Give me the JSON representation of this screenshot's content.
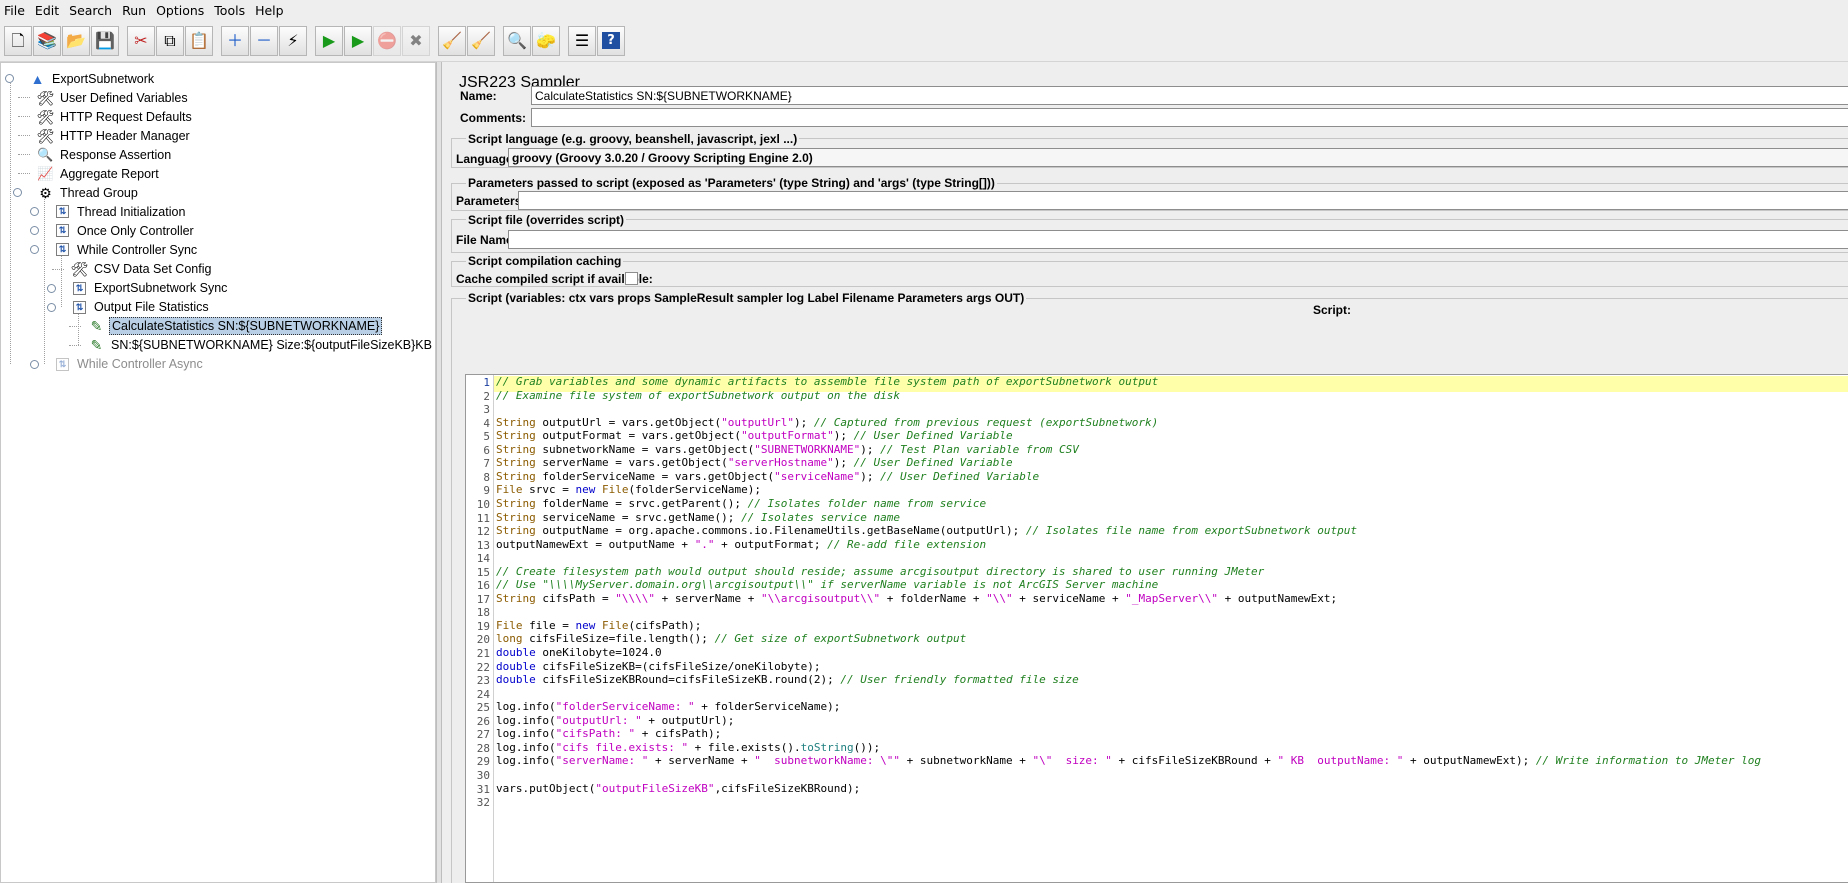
{
  "menu": [
    "File",
    "Edit",
    "Search",
    "Run",
    "Options",
    "Tools",
    "Help"
  ],
  "toolbar": [
    {
      "name": "new-icon",
      "glyph": "🗋"
    },
    {
      "name": "templates-icon",
      "glyph": "📚"
    },
    {
      "name": "open-icon",
      "glyph": "📂"
    },
    {
      "name": "save-icon",
      "glyph": "💾"
    },
    {
      "name": "cut-icon",
      "glyph": "✂"
    },
    {
      "name": "copy-icon",
      "glyph": "⧉"
    },
    {
      "name": "paste-icon",
      "glyph": "📋"
    },
    {
      "name": "expand-icon",
      "glyph": "＋"
    },
    {
      "name": "collapse-icon",
      "glyph": "－"
    },
    {
      "name": "toggle-icon",
      "glyph": "⚡"
    },
    {
      "name": "start-icon",
      "glyph": "▶"
    },
    {
      "name": "start-no-pauses-icon",
      "glyph": "▶"
    },
    {
      "name": "stop-icon",
      "glyph": "⛔"
    },
    {
      "name": "shutdown-icon",
      "glyph": "✖"
    },
    {
      "name": "clear-icon",
      "glyph": "🧹"
    },
    {
      "name": "clear-all-icon",
      "glyph": "🧹"
    },
    {
      "name": "search-icon",
      "glyph": "🔍"
    },
    {
      "name": "reset-search-icon",
      "glyph": "🧽"
    },
    {
      "name": "function-helper-icon",
      "glyph": "☰"
    },
    {
      "name": "help-icon",
      "glyph": "?"
    }
  ],
  "tree": [
    {
      "label": "ExportSubnetwork",
      "icon": "testplan-icon"
    },
    {
      "label": "User Defined Variables",
      "icon": "config-icon"
    },
    {
      "label": "HTTP Request Defaults",
      "icon": "config-icon"
    },
    {
      "label": "HTTP Header Manager",
      "icon": "config-icon"
    },
    {
      "label": "Response Assertion",
      "icon": "assertion-icon"
    },
    {
      "label": "Aggregate Report",
      "icon": "report-icon"
    },
    {
      "label": "Thread Group",
      "icon": "thread-group-icon"
    },
    {
      "label": "Thread Initialization",
      "icon": "controller-icon"
    },
    {
      "label": "Once Only Controller",
      "icon": "controller-icon"
    },
    {
      "label": "While Controller Sync",
      "icon": "controller-icon"
    },
    {
      "label": "CSV Data Set Config",
      "icon": "config-icon"
    },
    {
      "label": "ExportSubnetwork Sync",
      "icon": "controller-icon"
    },
    {
      "label": "Output File Statistics",
      "icon": "controller-icon"
    },
    {
      "label": "CalculateStatistics SN:${SUBNETWORKNAME}",
      "icon": "sampler-icon"
    },
    {
      "label": "SN:${SUBNETWORKNAME} Size:${outputFileSizeKB}KB",
      "icon": "sampler-icon"
    },
    {
      "label": "While Controller Async",
      "icon": "controller-icon"
    }
  ],
  "sampler": {
    "title": "JSR223 Sampler",
    "name_label": "Name:",
    "name_value": "CalculateStatistics SN:${SUBNETWORKNAME}",
    "comments_label": "Comments:",
    "comments_value": "",
    "lang_section": "Script language (e.g. groovy, beanshell, javascript, jexl ...)",
    "lang_label": "Language:",
    "lang_value": "groovy     (Groovy 3.0.20 / Groovy Scripting Engine 2.0)",
    "params_section": "Parameters passed to script (exposed as 'Parameters' (type String) and 'args' (type String[]))",
    "params_label": "Parameters:",
    "params_value": "",
    "file_section": "Script file (overrides script)",
    "file_label": "File Name:",
    "file_value": "",
    "cache_section": "Script compilation caching",
    "cache_label": "Cache compiled script if available:",
    "cache_checked": false,
    "script_section": "Script (variables: ctx vars props SampleResult sampler log Label Filename Parameters args OUT)",
    "script_header": "Script:"
  },
  "editor": {
    "current_line": 1,
    "highlight_color": "#ffffaa",
    "lines": [
      "// Grab variables and some dynamic artifacts to assemble file system path of exportSubnetwork output",
      "// Examine file system of exportSubnetwork output on the disk",
      "",
      "String outputUrl = vars.getObject(\"outputUrl\"); // Captured from previous request (exportSubnetwork)",
      "String outputFormat = vars.getObject(\"outputFormat\"); // User Defined Variable",
      "String subnetworkName = vars.getObject(\"SUBNETWORKNAME\"); // Test Plan variable from CSV",
      "String serverName = vars.getObject(\"serverHostname\"); // User Defined Variable",
      "String folderServiceName = vars.getObject(\"serviceName\"); // User Defined Variable",
      "File srvc = new File(folderServiceName);",
      "String folderName = srvc.getParent(); // Isolates folder name from service",
      "String serviceName = srvc.getName(); // Isolates service name",
      "String outputName = org.apache.commons.io.FilenameUtils.getBaseName(outputUrl); // Isolates file name from exportSubnetwork output",
      "outputNamewExt = outputName + \".\" + outputFormat; // Re-add file extension",
      "",
      "// Create filesystem path would output should reside; assume arcgisoutput directory is shared to user running JMeter",
      "// Use \"\\\\\\\\MyServer.domain.org\\\\arcgisoutput\\\\\" if serverName variable is not ArcGIS Server machine",
      "String cifsPath = \"\\\\\\\\\" + serverName + \"\\\\arcgisoutput\\\\\" + folderName + \"\\\\\" + serviceName + \"_MapServer\\\\\" + outputNamewExt;",
      "",
      "File file = new File(cifsPath);",
      "long cifsFileSize=file.length(); // Get size of exportSubnetwork output",
      "double oneKilobyte=1024.0",
      "double cifsFileSizeKB=(cifsFileSize/oneKilobyte);",
      "double cifsFileSizeKBRound=cifsFileSizeKB.round(2); // User friendly formatted file size",
      "",
      "log.info(\"folderServiceName: \" + folderServiceName);",
      "log.info(\"outputUrl: \" + outputUrl);",
      "log.info(\"cifsPath: \" + cifsPath);",
      "log.info(\"cifs file.exists: \" + file.exists().toString());",
      "log.info(\"serverName: \" + serverName + \"  subnetworkName: \\\"\" + subnetworkName + \"\\\"  size: \" + cifsFileSizeKBRound + \" KB  outputName: \" + outputNamewExt); // Write information to JMeter log",
      "",
      "vars.putObject(\"outputFileSizeKB\",cifsFileSizeKBRound);",
      ""
    ]
  }
}
